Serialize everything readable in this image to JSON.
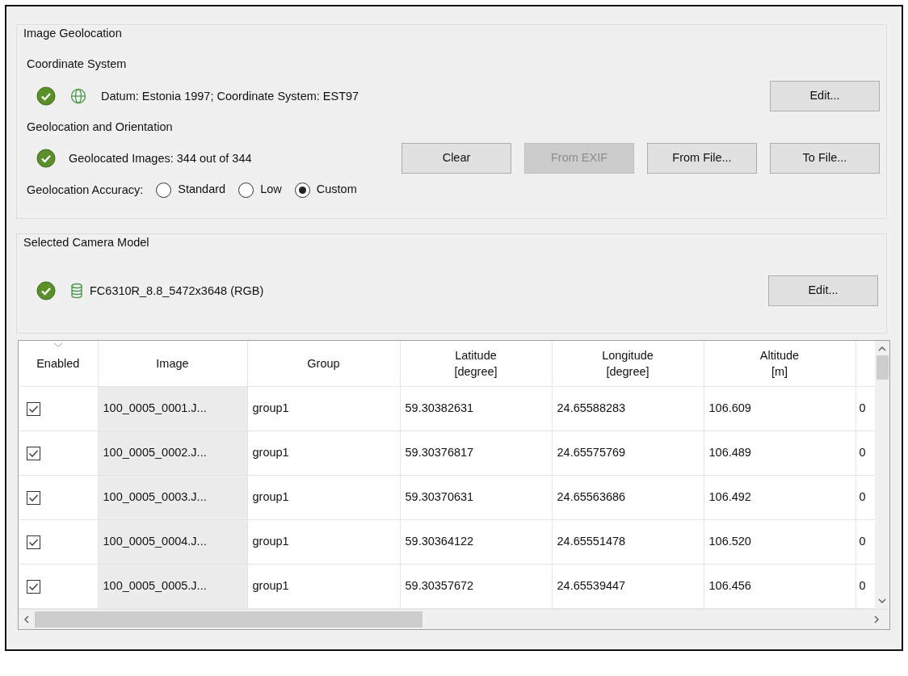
{
  "image_geolocation": {
    "title": "Image Geolocation",
    "coordinate_system": {
      "label": "Coordinate System",
      "text": "Datum: Estonia 1997; Coordinate System: EST97",
      "button": {
        "label": "Edit...",
        "disabled": false
      }
    },
    "geolocation_orientation": {
      "label": "Geolocation and Orientation",
      "text": "Geolocated Images: 344 out of 344",
      "buttons": [
        {
          "label": "Clear",
          "disabled": false
        },
        {
          "label": "From EXIF",
          "disabled": true
        },
        {
          "label": "From File...",
          "disabled": false
        },
        {
          "label": "To File...",
          "disabled": false
        }
      ]
    },
    "accuracy": {
      "label": "Geolocation Accuracy:",
      "options": [
        {
          "label": "Standard",
          "selected": false
        },
        {
          "label": "Low",
          "selected": false
        },
        {
          "label": "Custom",
          "selected": true
        }
      ]
    }
  },
  "camera_model": {
    "title": "Selected Camera Model",
    "text": "FC6310R_8.8_5472x3648 (RGB)",
    "button": {
      "label": "Edit...",
      "disabled": false
    }
  },
  "table": {
    "columns": [
      {
        "label": "Enabled"
      },
      {
        "label": "Image"
      },
      {
        "label": "Group"
      },
      {
        "label": "Latitude",
        "unit": "[degree]"
      },
      {
        "label": "Longitude",
        "unit": "[degree]"
      },
      {
        "label": "Altitude",
        "unit": "[m]"
      }
    ],
    "rows": [
      {
        "enabled": true,
        "image": "100_0005_0001.J...",
        "group": "group1",
        "latitude": "59.30382631",
        "longitude": "24.65588283",
        "altitude": "106.609",
        "column_7": "0"
      },
      {
        "enabled": true,
        "image": "100_0005_0002.J...",
        "group": "group1",
        "latitude": "59.30376817",
        "longitude": "24.65575769",
        "altitude": "106.489",
        "column_7": "0"
      },
      {
        "enabled": true,
        "image": "100_0005_0003.J...",
        "group": "group1",
        "latitude": "59.30370631",
        "longitude": "24.65563686",
        "altitude": "106.492",
        "column_7": "0"
      },
      {
        "enabled": true,
        "image": "100_0005_0004.J...",
        "group": "group1",
        "latitude": "59.30364122",
        "longitude": "24.65551478",
        "altitude": "106.520",
        "column_7": "0"
      },
      {
        "enabled": true,
        "image": "100_0005_0005.J...",
        "group": "group1",
        "latitude": "59.30357672",
        "longitude": "24.65539447",
        "altitude": "106.456",
        "column_7": "0"
      }
    ]
  }
}
